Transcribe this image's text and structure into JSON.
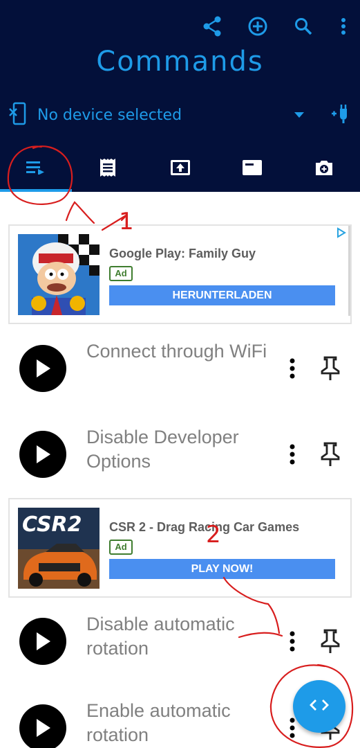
{
  "header": {
    "title": "Commands",
    "device_status": "No device selected",
    "actions": [
      "share-icon",
      "add-circle-icon",
      "search-icon",
      "more-vert-icon"
    ],
    "background": "#03103a",
    "accent": "#1e9be8"
  },
  "tabs": [
    {
      "icon": "queue-list-icon",
      "active": true
    },
    {
      "icon": "receipt-icon",
      "active": false
    },
    {
      "icon": "upload-box-icon",
      "active": false
    },
    {
      "icon": "window-icon",
      "active": false
    },
    {
      "icon": "camera-add-icon",
      "active": false
    }
  ],
  "ads": [
    {
      "headline": "Google Play: Family Guy",
      "badge": "Ad",
      "cta": "HERUNTERLADEN"
    },
    {
      "headline": "CSR 2 - Drag Racing Car Games",
      "badge": "Ad",
      "cta": "PLAY NOW!",
      "thumb_text": "CSR2"
    }
  ],
  "commands": [
    {
      "label": "Connect through WiFi"
    },
    {
      "label": "Disable Developer Options"
    },
    {
      "label": "Disable automatic rotation"
    },
    {
      "label": "Enable automatic rotation"
    }
  ],
  "annotations": {
    "mark1": "1",
    "mark2": "2",
    "color": "#d81e1e"
  }
}
